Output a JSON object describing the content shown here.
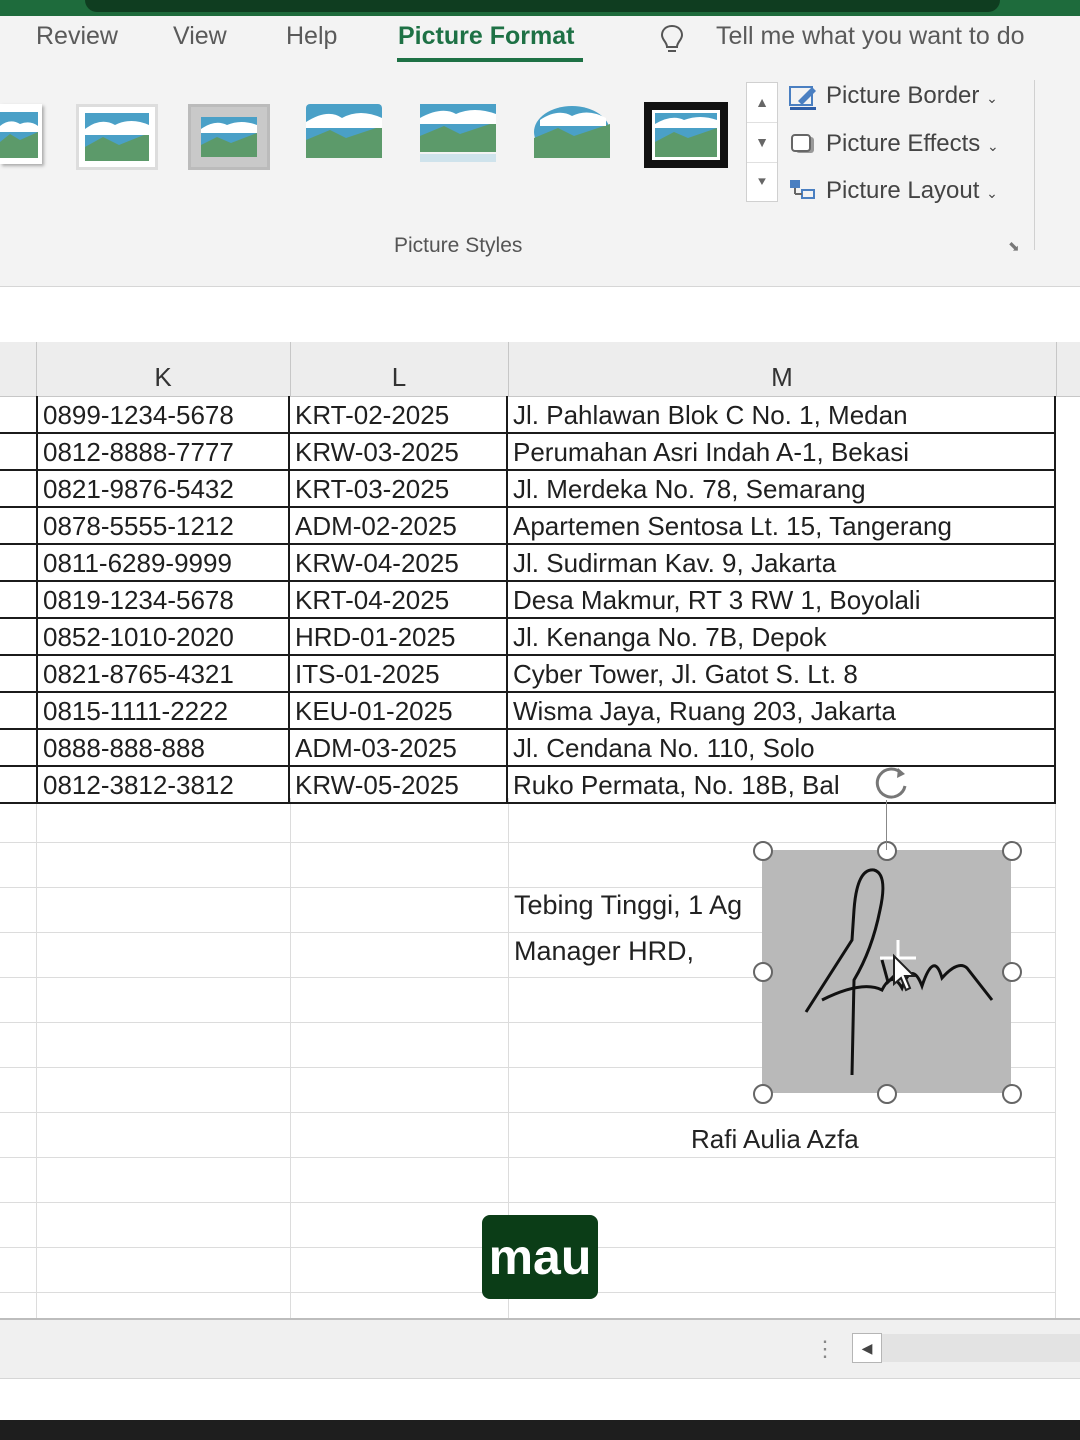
{
  "ribbon": {
    "tabs": [
      "Review",
      "View",
      "Help",
      "Picture Format"
    ],
    "active_tab": "Picture Format",
    "tell_me": "Tell me what you want to do",
    "commands": [
      "Picture Border",
      "Picture Effects",
      "Picture Layout"
    ],
    "group_label": "Picture Styles"
  },
  "columns": [
    "K",
    "L",
    "M"
  ],
  "rows": [
    [
      "0899-1234-5678",
      "KRT-02-2025",
      "Jl. Pahlawan Blok C No. 1, Medan"
    ],
    [
      "0812-8888-7777",
      "KRW-03-2025",
      "Perumahan Asri Indah A-1, Bekasi"
    ],
    [
      "0821-9876-5432",
      "KRT-03-2025",
      "Jl. Merdeka No. 78, Semarang"
    ],
    [
      "0878-5555-1212",
      "ADM-02-2025",
      "Apartemen Sentosa Lt. 15, Tangerang"
    ],
    [
      "0811-6289-9999",
      "KRW-04-2025",
      "Jl. Sudirman Kav. 9, Jakarta"
    ],
    [
      "0819-1234-5678",
      "KRT-04-2025",
      "Desa Makmur, RT 3 RW 1, Boyolali"
    ],
    [
      "0852-1010-2020",
      "HRD-01-2025",
      "Jl. Kenanga No. 7B, Depok"
    ],
    [
      "0821-8765-4321",
      "ITS-01-2025",
      "Cyber Tower, Jl. Gatot S. Lt. 8"
    ],
    [
      "0815-1111-2222",
      "KEU-01-2025",
      "Wisma Jaya, Ruang 203, Jakarta"
    ],
    [
      "0888-888-888",
      "ADM-03-2025",
      "Jl. Cendana No. 110, Solo"
    ],
    [
      "0812-3812-3812",
      "KRW-05-2025",
      "Ruko Permata, No. 18B, Bal"
    ]
  ],
  "sheet": {
    "place_date": "Tebing Tinggi, 1 Ag",
    "position": "Manager HRD,",
    "signer": "Rafi Aulia Azfa"
  },
  "caption": "mau",
  "colors": {
    "accent": "#1e7145",
    "caption_bg": "#0b3d17"
  },
  "icons": [
    "lightbulb-icon",
    "picture-border-icon",
    "picture-effects-icon",
    "picture-layout-icon",
    "rotate-icon",
    "signature-image"
  ]
}
